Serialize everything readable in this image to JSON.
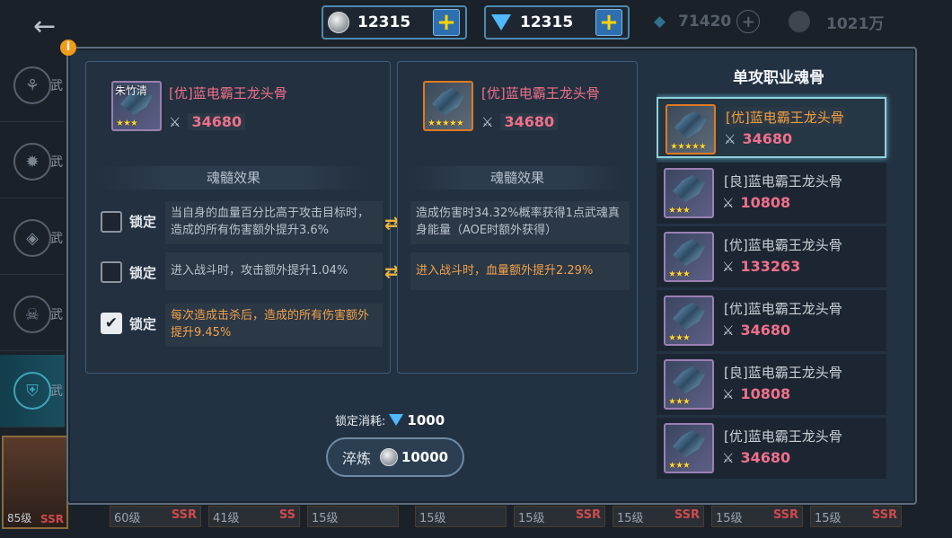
{
  "currency": {
    "silver": "12315",
    "diamond": "12315",
    "dim_gem": "71420",
    "dim_coin": "1021万"
  },
  "background": {
    "nav": [
      "武",
      "武",
      "武",
      "武",
      "武"
    ],
    "portrait": {
      "level": "85级",
      "rarity": "SSR"
    },
    "cards": [
      {
        "level": "60级",
        "rarity": "SSR"
      },
      {
        "level": "41级",
        "rarity": "SS"
      },
      {
        "level": "15级",
        "rarity": ""
      },
      {
        "level": "15级",
        "rarity": ""
      },
      {
        "level": "15级",
        "rarity": "SSR"
      },
      {
        "level": "15级",
        "rarity": "SSR"
      },
      {
        "level": "15级",
        "rarity": "SSR"
      },
      {
        "level": "15级",
        "rarity": "SSR"
      }
    ]
  },
  "left_panel": {
    "owner": "朱竹清",
    "item_name": "[优]蓝电霸王龙头骨",
    "power": "34680",
    "stars": "★★★",
    "section_title": "魂髓效果",
    "lock_label": "锁定",
    "effects": [
      {
        "text": "当自身的血量百分比高于攻击目标时，造成的所有伤害额外提升3.6%",
        "locked": false
      },
      {
        "text": "进入战斗时，攻击额外提升1.04%",
        "locked": false
      },
      {
        "text": "每次造成击杀后，造成的所有伤害额外提升9.45%",
        "locked": true
      }
    ]
  },
  "mid_panel": {
    "item_name": "[优]蓝电霸王龙头骨",
    "power": "34680",
    "stars": "★★★★★",
    "section_title": "魂髓效果",
    "effects": [
      {
        "text": "造成伤害时34.32%概率获得1点武魂真身能量（AOE时额外获得）"
      },
      {
        "text": "进入战斗时，血量额外提升2.29%"
      }
    ]
  },
  "lock_cost": {
    "label": "锁定消耗:",
    "value": "1000"
  },
  "refine_button": {
    "label": "淬炼",
    "cost": "10000"
  },
  "list": {
    "title": "单攻职业魂骨",
    "items": [
      {
        "name": "[优]蓝电霸王龙头骨",
        "power": "34680",
        "stars": "★★★★★",
        "selected": true
      },
      {
        "name": "[良]蓝电霸王龙头骨",
        "power": "10808",
        "stars": "★★★",
        "selected": false
      },
      {
        "name": "[优]蓝电霸王龙头骨",
        "power": "133263",
        "stars": "★★★",
        "selected": false
      },
      {
        "name": "[优]蓝电霸王龙头骨",
        "power": "34680",
        "stars": "★★★",
        "selected": false
      },
      {
        "name": "[良]蓝电霸王龙头骨",
        "power": "10808",
        "stars": "★★★",
        "selected": false
      },
      {
        "name": "[优]蓝电霸王龙头骨",
        "power": "34680",
        "stars": "★★★",
        "selected": false
      }
    ]
  },
  "icons": {
    "back": "back-arrow-icon",
    "swap": "swap-arrows-icon",
    "info": "info-icon",
    "power": "crossed-swords-icon"
  },
  "colors": {
    "name_pink": "#f0708a",
    "effect_orange": "#f2a24a",
    "selected_border": "#8fd0dc",
    "orange_frame": "#e07a1f",
    "purple_frame": "#9b7fb2"
  }
}
